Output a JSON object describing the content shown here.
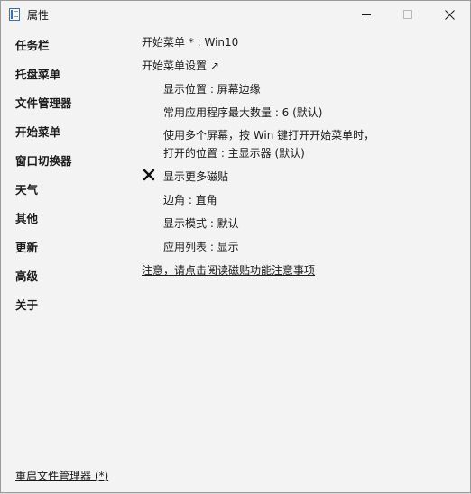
{
  "window": {
    "title": "属性"
  },
  "sidebar": {
    "items": [
      {
        "label": "任务栏"
      },
      {
        "label": "托盘菜单"
      },
      {
        "label": "文件管理器"
      },
      {
        "label": "开始菜单"
      },
      {
        "label": "窗口切换器"
      },
      {
        "label": "天气"
      },
      {
        "label": "其他"
      },
      {
        "label": "更新"
      },
      {
        "label": "高级"
      },
      {
        "label": "关于"
      }
    ],
    "restart_link": "重启文件管理器 (*)"
  },
  "main": {
    "start_menu_line": "开始菜单 * : Win10",
    "settings_link": "开始菜单设置 ↗",
    "display_position": "显示位置 : 屏幕边缘",
    "max_frequent_apps": "常用应用程序最大数量 : 6 (默认)",
    "multi_screen_line1": "使用多个屏幕，按 Win 键打开开始菜单时，",
    "multi_screen_line2": "打开的位置 : 主显示器 (默认)",
    "show_more_tiles": "显示更多磁贴",
    "corner": "边角 : 直角",
    "display_mode": "显示模式 : 默认",
    "app_list": "应用列表 : 显示",
    "notice_link": "注意，请点击阅读磁贴功能注意事项"
  },
  "icons": {
    "app": "app-icon",
    "minimize": "minimize-icon",
    "maximize": "maximize-icon",
    "close": "close-icon",
    "unchecked": "x-icon"
  }
}
